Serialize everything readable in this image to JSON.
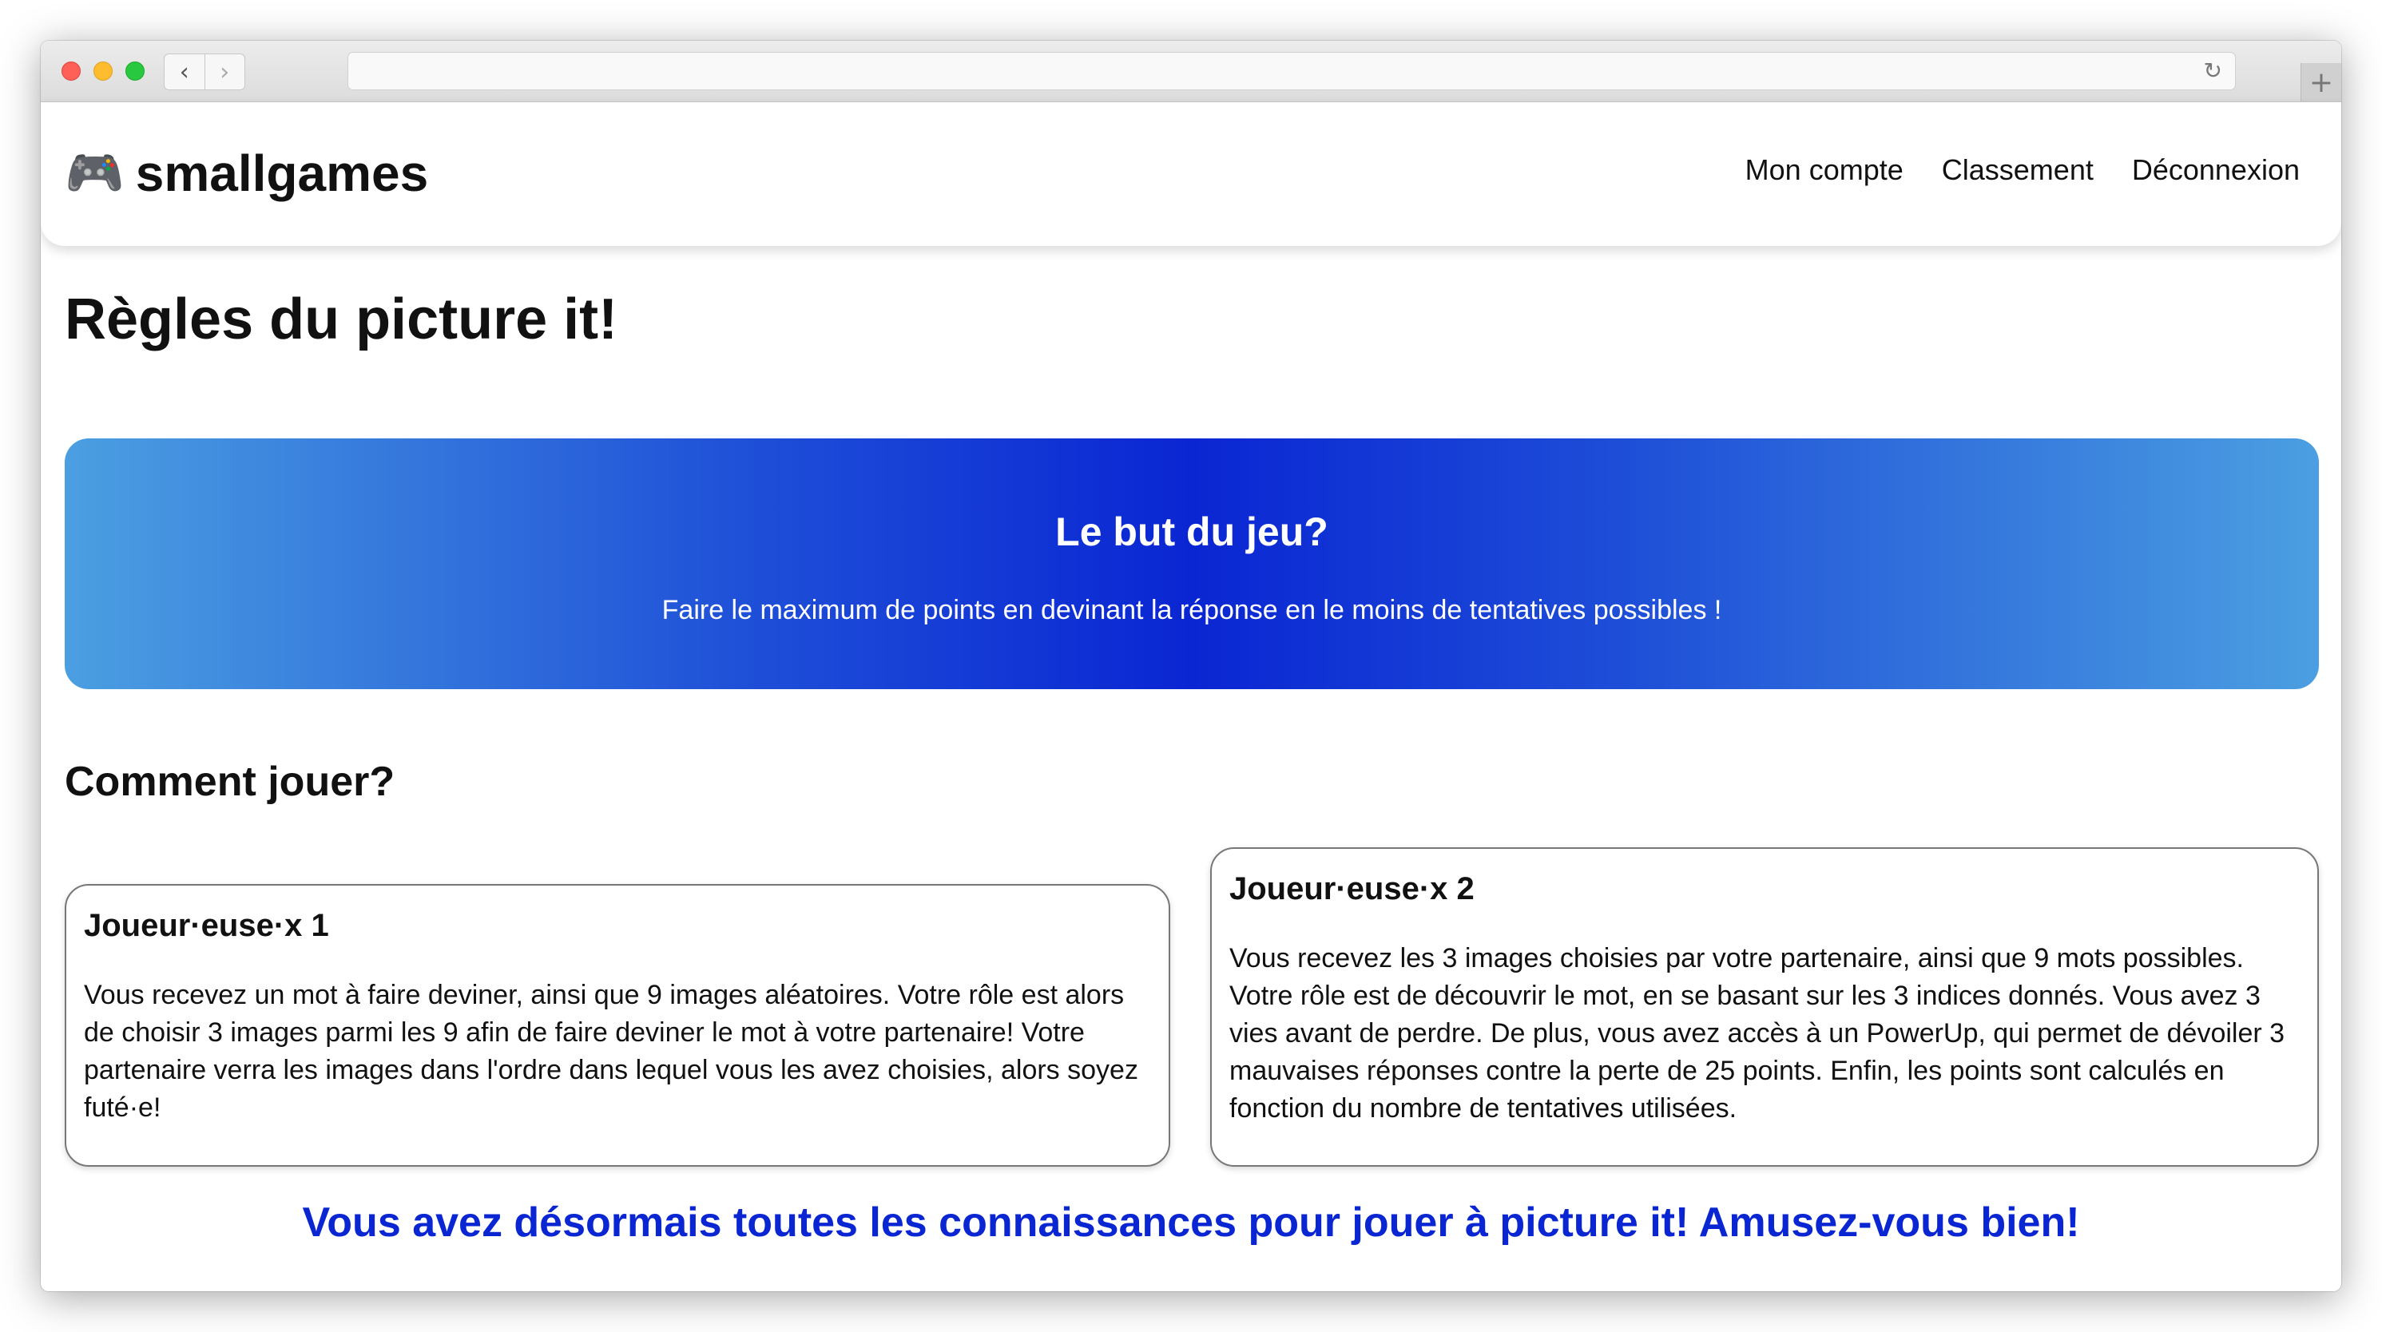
{
  "browser": {
    "back_icon": "‹",
    "forward_icon": "›",
    "reload_icon": "↻",
    "new_tab_icon": "+"
  },
  "header": {
    "brand_icon": "🎮",
    "brand": "smallgames",
    "nav": [
      "Mon compte",
      "Classement",
      "Déconnexion"
    ]
  },
  "main": {
    "title": "Règles du picture it!",
    "goal": {
      "title": "Le but du jeu?",
      "text": "Faire le maximum de points en devinant la réponse en le moins de tentatives possibles !"
    },
    "how_title": "Comment jouer?",
    "players": [
      {
        "title": "Joueur·euse·x 1",
        "text": "Vous recevez un mot à faire deviner, ainsi que 9 images aléatoires. Votre rôle est alors de choisir 3 images parmi les 9 afin de faire deviner le mot à votre partenaire! Votre partenaire verra les images dans l'ordre dans lequel vous les avez choisies, alors soyez futé·e!"
      },
      {
        "title": "Joueur·euse·x 2",
        "text": "Vous recevez les 3 images choisies par votre partenaire, ainsi que 9 mots possibles. Votre rôle est de découvrir le mot, en se basant sur les 3 indices donnés. Vous avez 3 vies avant de perdre. De plus, vous avez accès à un PowerUp, qui permet de dévoiler 3 mauvaises réponses contre la perte de 25 points. Enfin, les points sont calculés en fonction du nombre de tentatives utilisées."
      }
    ],
    "outro": "Vous avez désormais toutes les connaissances pour jouer à picture it! Amusez-vous bien!"
  },
  "colors": {
    "accent": "#0a26d3",
    "gradient_edge": "#4b9fe1",
    "gradient_center": "#0a26d3"
  }
}
